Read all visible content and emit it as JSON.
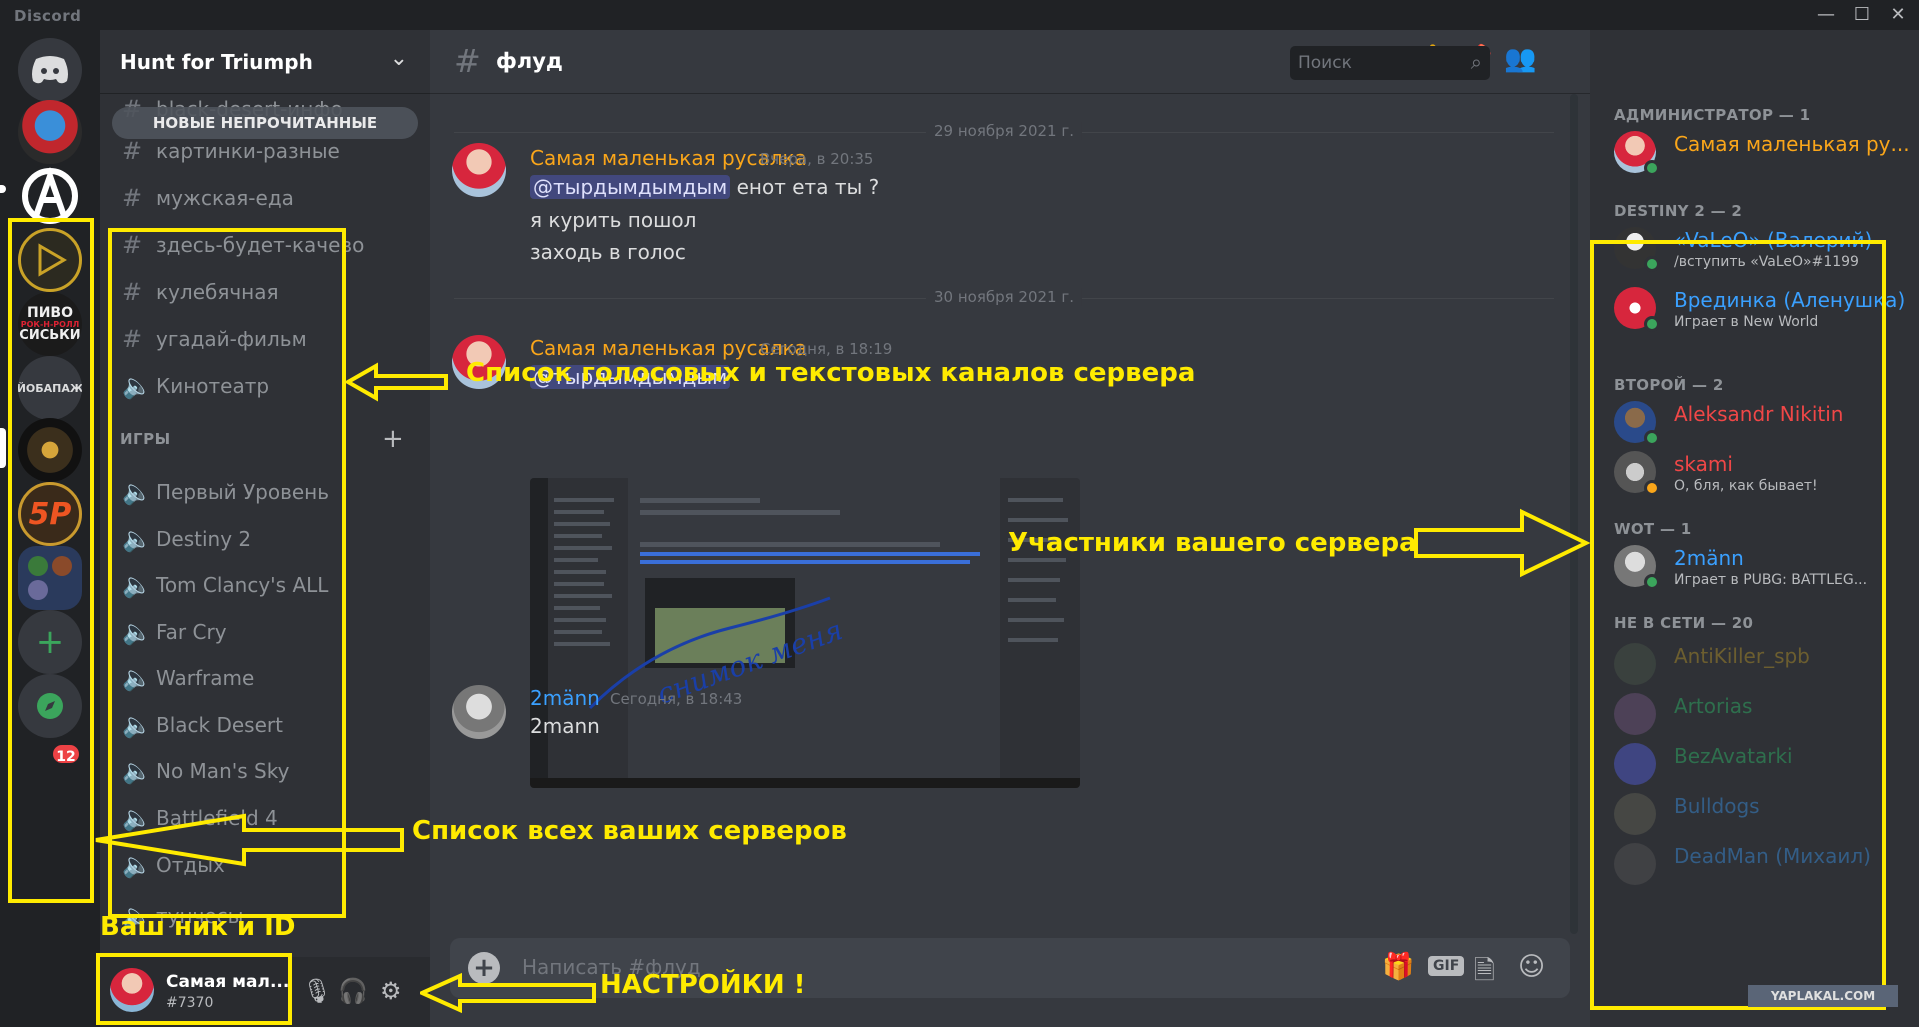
{
  "app": {
    "brand": "Discord"
  },
  "colors": {
    "accent": "#5865f2",
    "annotation": "#ffeb00",
    "online": "#3ba55c"
  },
  "rail": {
    "servers": [
      "hunt-for-triumph",
      "anarchy",
      "triangle",
      "pivo",
      "yobapazh",
      "eagle",
      "5p",
      "folder"
    ],
    "labels": {
      "pivo_top": "ПИВО",
      "pivo_mid": "РОК-Н-РОЛЛ",
      "pivo_bot": "СИСЬКИ",
      "yobapazh": "ЙОБАПАЖ",
      "fivep": "5P"
    },
    "badge": "12",
    "add_icon": "+",
    "explore_icon": "compass-icon"
  },
  "sidebar": {
    "guild_name": "Hunt for Triumph",
    "unread_banner": "НОВЫЕ НЕПРОЧИТАННЫЕ",
    "category": "ИГРЫ",
    "channels_top": [
      {
        "icon": "#",
        "name": "black-desert-инфо"
      },
      {
        "icon": "#",
        "name": "картинки-разные"
      },
      {
        "icon": "#",
        "name": "мужская-еда"
      },
      {
        "icon": "#",
        "name": "здесь-будет-качево"
      },
      {
        "icon": "#",
        "name": "кулебячная"
      },
      {
        "icon": "#",
        "name": "угадай-фильм"
      },
      {
        "icon": "🔈",
        "name": "Кинотеатр"
      }
    ],
    "channels_games": [
      {
        "icon": "🔈",
        "name": "Первый Уровень"
      },
      {
        "icon": "🔈",
        "name": "Destiny 2"
      },
      {
        "icon": "🔈",
        "name": "Tom Clancy's ALL"
      },
      {
        "icon": "🔈",
        "name": "Far Cry"
      },
      {
        "icon": "🔈",
        "name": "Warframe"
      },
      {
        "icon": "🔈",
        "name": "Black Desert"
      },
      {
        "icon": "🔈",
        "name": "No Man's Sky"
      },
      {
        "icon": "🔈",
        "name": "Battlefield 4"
      },
      {
        "icon": "🔈",
        "name": "Отдых"
      },
      {
        "icon": "🔈",
        "name": "тунчесы"
      }
    ]
  },
  "user": {
    "name": "Самая мал...",
    "tag": "#7370"
  },
  "chat": {
    "channel": "флуд",
    "search_placeholder": "Поиск",
    "composer_placeholder": "Написать #флуд",
    "gif_label": "GIF",
    "dates": [
      "29 ноября 2021 г.",
      "30 ноября 2021 г."
    ],
    "messages": [
      {
        "author": "Самая маленькая русалка",
        "time": "Вчера, в 20:35",
        "mention": "@тырдымдымдым",
        "lines": [
          "енот ета ты ?",
          "я курить пошол",
          "заходь в голос"
        ]
      },
      {
        "author": "Самая маленькая русалка",
        "time": "Сегодня, в 18:19",
        "mention": "@тырдымдымдым",
        "lines": []
      },
      {
        "author": "2männ",
        "time": "Сегодня, в 18:43",
        "mention": "",
        "lines": [
          "2mann"
        ]
      }
    ],
    "attachment_text": "снимок меня"
  },
  "members": {
    "groups": [
      {
        "title": "АДМИНИСТРАТОР — 1",
        "items": [
          {
            "name": "Самая маленькая ру...",
            "sub": "",
            "color": "#faa61a"
          }
        ]
      },
      {
        "title": "DESTINY 2 — 2",
        "items": [
          {
            "name": "«VaLeO» (Валерий)",
            "sub": "/вступить «VaLeO»#1199",
            "color": "#3aa0ff"
          },
          {
            "name": "Врединка (Аленушка)",
            "sub": "Играет в New World",
            "color": "#3aa0ff"
          }
        ]
      },
      {
        "title": "ВТОРОЙ — 2",
        "items": [
          {
            "name": "Aleksandr Nikitin",
            "sub": "",
            "color": "#f04747"
          },
          {
            "name": "skami",
            "sub": "О, бля, как бывает!",
            "color": "#f04747"
          }
        ]
      },
      {
        "title": "WOT — 1",
        "items": [
          {
            "name": "2männ",
            "sub": "Играет в PUBG: BATTLEG...",
            "color": "#3aa0ff"
          }
        ]
      },
      {
        "title": "НЕ В СЕТИ — 20",
        "items": [
          {
            "name": "AntiKiller_spb",
            "sub": "",
            "color": "#c9a227"
          },
          {
            "name": "Artorias",
            "sub": "",
            "color": "#2ecc71"
          },
          {
            "name": "BezAvatarki",
            "sub": "",
            "color": "#2ecc71"
          },
          {
            "name": "Bulldogs",
            "sub": "",
            "color": "#3aa0ff"
          },
          {
            "name": "DeadMan (Михаил)",
            "sub": "",
            "color": "#3aa0ff"
          }
        ]
      }
    ]
  },
  "annotations": {
    "channels": "Список голосовых и текстовых каналов сервера",
    "members": "Участники вашего сервера",
    "servers": "Список всех ваших серверов",
    "nick": "Ваш ник и ID",
    "settings": "НАСТРОЙКИ !"
  },
  "watermark": "YAPLAKAL.COM"
}
